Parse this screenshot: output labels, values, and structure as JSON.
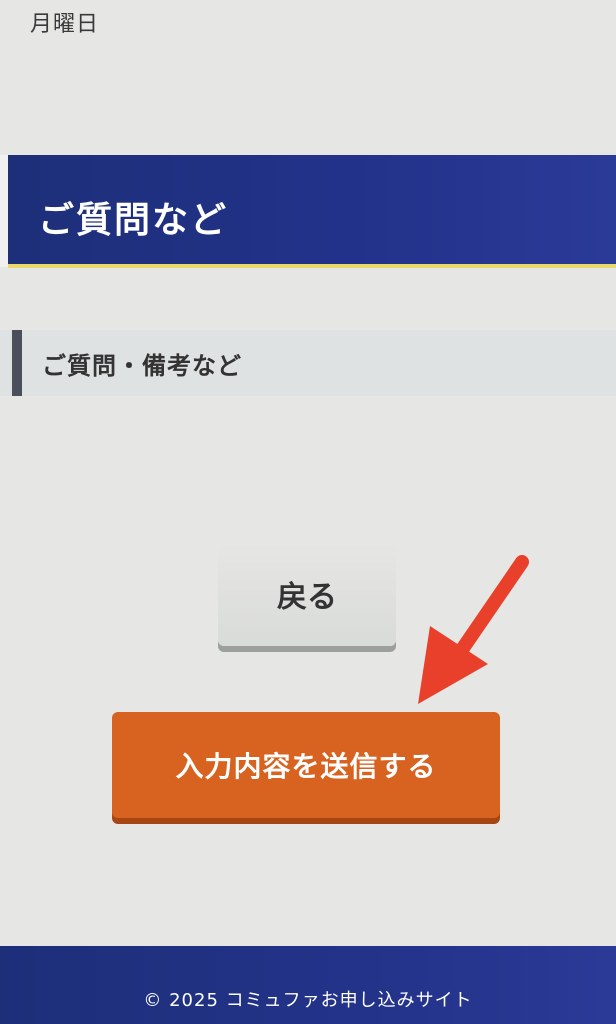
{
  "top_text": "月曜日",
  "section": {
    "title": "ご質問など",
    "subheading": "ご質問・備考など"
  },
  "buttons": {
    "back": "戻る",
    "submit": "入力内容を送信する"
  },
  "footer": {
    "copyright": "© 2025 コミュファお申し込みサイト"
  },
  "colors": {
    "banner": "#1d2f79",
    "banner_underline": "#e8d96a",
    "submit": "#d8621f",
    "annotation_arrow": "#e8402a"
  },
  "icons": {
    "annotation": "red-arrow-icon"
  }
}
